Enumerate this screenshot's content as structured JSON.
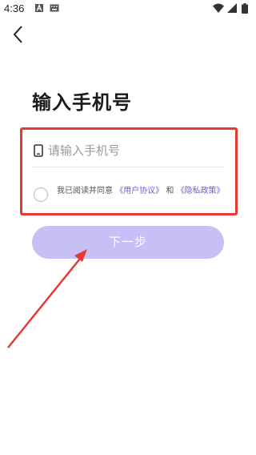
{
  "status_bar": {
    "time": "4:36",
    "left_icons": [
      "app-a-icon",
      "keyboard-icon"
    ],
    "right_icons": [
      "wifi-icon",
      "signal-icon",
      "battery-icon"
    ]
  },
  "nav": {
    "back_icon": "chevron-left-icon"
  },
  "page": {
    "title": "输入手机号",
    "phone_input": {
      "placeholder": "请输入手机号",
      "value": ""
    },
    "agreement": {
      "checked": false,
      "prefix": "我已阅读并同意",
      "user_agreement": "《用户协议》",
      "conjunction": "和",
      "privacy_policy": "《隐私政策》"
    },
    "next_button": {
      "label": "下一步",
      "enabled": false
    }
  },
  "colors": {
    "annotation": "#e53935",
    "accent": "#6b5fd6",
    "button_disabled": "#c7c0f6"
  }
}
